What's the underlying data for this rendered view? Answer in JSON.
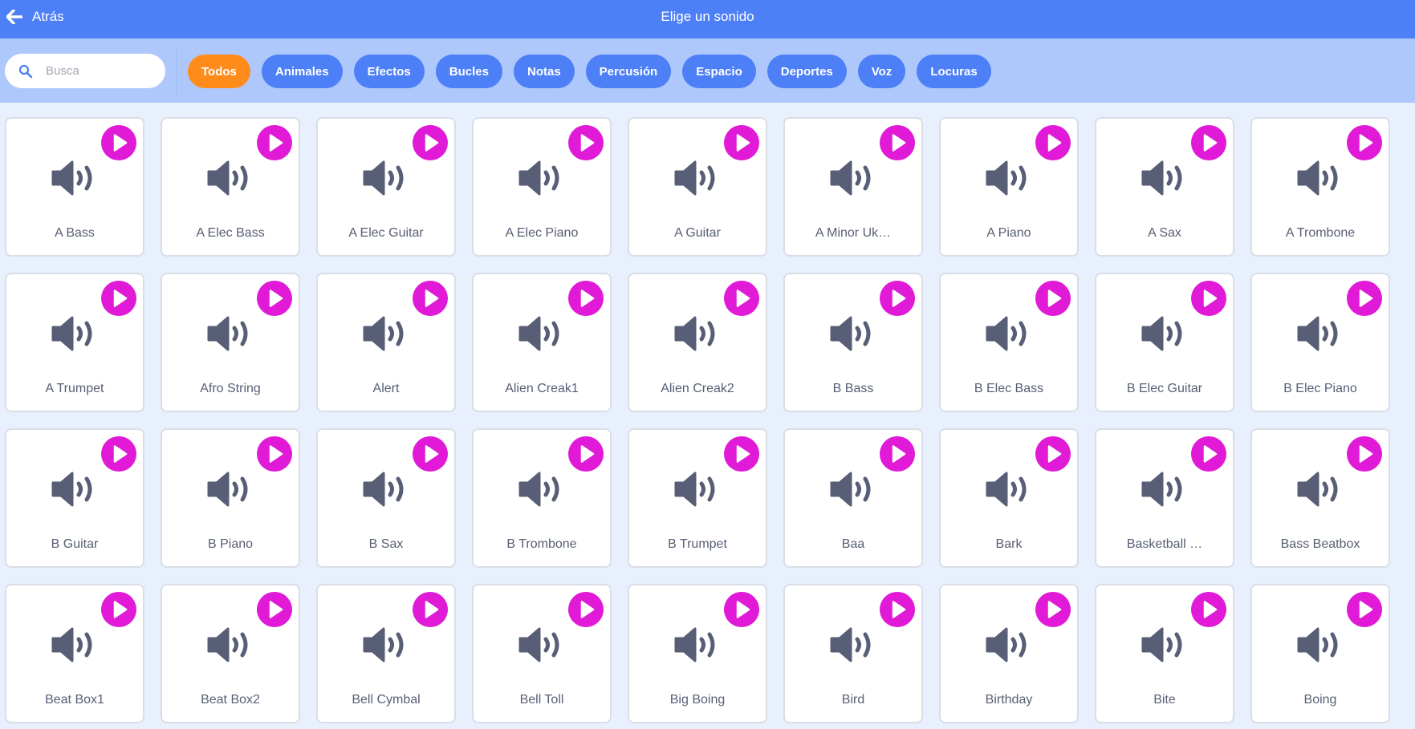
{
  "header": {
    "back_label": "Atrás",
    "title": "Elige un sonido"
  },
  "search": {
    "placeholder": "Busca",
    "value": ""
  },
  "tags": [
    {
      "label": "Todos",
      "active": true
    },
    {
      "label": "Animales",
      "active": false
    },
    {
      "label": "Efectos",
      "active": false
    },
    {
      "label": "Bucles",
      "active": false
    },
    {
      "label": "Notas",
      "active": false
    },
    {
      "label": "Percusión",
      "active": false
    },
    {
      "label": "Espacio",
      "active": false
    },
    {
      "label": "Deportes",
      "active": false
    },
    {
      "label": "Voz",
      "active": false
    },
    {
      "label": "Locuras",
      "active": false
    }
  ],
  "sounds": [
    "A Bass",
    "A Elec Bass",
    "A Elec Guitar",
    "A Elec Piano",
    "A Guitar",
    "A Minor Uk…",
    "A Piano",
    "A Sax",
    "A Trombone",
    "A Trumpet",
    "Afro String",
    "Alert",
    "Alien Creak1",
    "Alien Creak2",
    "B Bass",
    "B Elec Bass",
    "B Elec Guitar",
    "B Elec Piano",
    "B Guitar",
    "B Piano",
    "B Sax",
    "B Trombone",
    "B Trumpet",
    "Baa",
    "Bark",
    "Basketball …",
    "Bass Beatbox",
    "Beat Box1",
    "Beat Box2",
    "Bell Cymbal",
    "Bell Toll",
    "Big Boing",
    "Bird",
    "Birthday",
    "Bite",
    "Boing"
  ],
  "icons": {
    "back": "arrow-left-icon",
    "search": "search-icon",
    "play": "play-icon",
    "sound": "speaker-icon"
  },
  "colors": {
    "header": "#4d7ff7",
    "filter_bar": "#aec8fb",
    "background": "#e8f0fd",
    "tag": "#4d7ff7",
    "tag_active": "#ff8c1a",
    "play": "#e01ad6",
    "speaker": "#575e75",
    "label_text": "#575e75"
  }
}
